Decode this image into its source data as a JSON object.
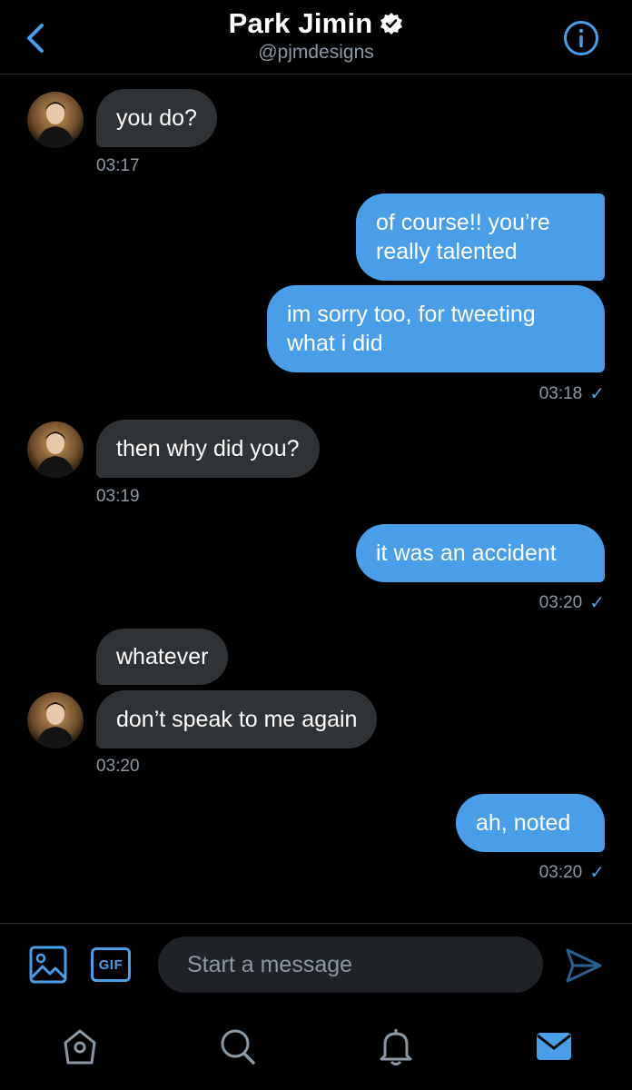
{
  "header": {
    "name": "Park Jimin",
    "handle": "@pjmdesigns"
  },
  "messages": [
    {
      "side": "in",
      "text": "you do?"
    },
    {
      "side": "in_time",
      "time": "03:17"
    },
    {
      "side": "out",
      "text": "of course!! you’re really talented"
    },
    {
      "side": "out",
      "text": "im sorry too, for tweeting what i did"
    },
    {
      "side": "out_time",
      "time": "03:18"
    },
    {
      "side": "in",
      "text": "then why did you?"
    },
    {
      "side": "in_time",
      "time": "03:19"
    },
    {
      "side": "out",
      "text": "it was an accident"
    },
    {
      "side": "out_time",
      "time": "03:20"
    },
    {
      "side": "in",
      "text": "whatever"
    },
    {
      "side": "in",
      "text": "don’t speak to me again"
    },
    {
      "side": "in_time",
      "time": "03:20"
    },
    {
      "side": "out",
      "text": "ah, noted"
    },
    {
      "side": "out_time",
      "time": "03:20"
    }
  ],
  "composer": {
    "gif_label": "GIF",
    "placeholder": "Start a message"
  },
  "icons": {
    "back": "chevron-left-icon",
    "info": "info-icon",
    "verified": "verified-badge-icon",
    "media": "image-icon",
    "send": "send-icon",
    "home": "home-icon",
    "search": "search-icon",
    "notifications": "bell-icon",
    "messages": "mail-icon"
  },
  "colors": {
    "background": "#000000",
    "accent": "#4a9ee8",
    "incoming_bubble": "#2f3336",
    "muted_text": "#8b98a5"
  }
}
